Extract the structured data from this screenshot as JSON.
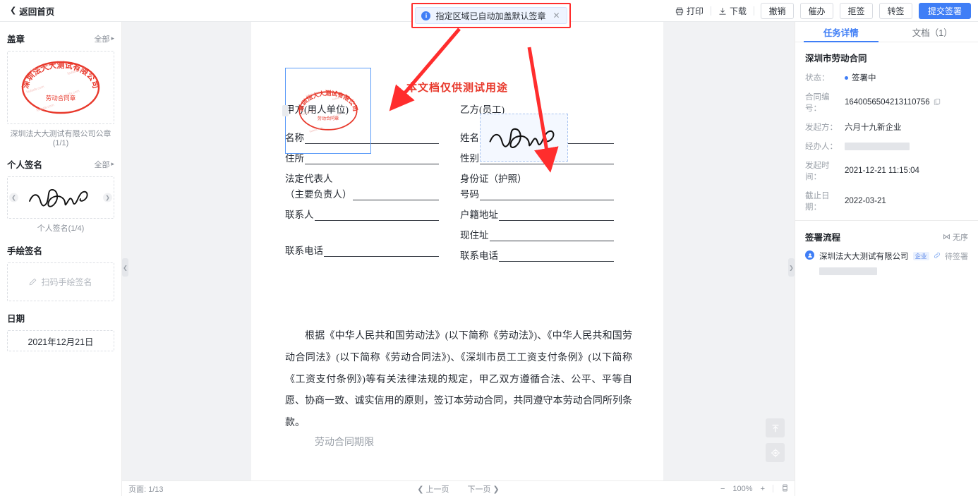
{
  "topbar": {
    "back_label": "返回首页",
    "actions_text": [
      {
        "id": "print",
        "label": "打印",
        "icon": "printer-icon"
      },
      {
        "id": "download",
        "label": "下载",
        "icon": "download-icon"
      }
    ],
    "actions_buttons": [
      {
        "id": "revoke",
        "label": "撤销"
      },
      {
        "id": "urge",
        "label": "催办"
      },
      {
        "id": "reject",
        "label": "拒签"
      },
      {
        "id": "transfer",
        "label": "转签"
      }
    ],
    "primary_button": "提交签署"
  },
  "notice": {
    "text": "指定区域已自动加盖默认签章",
    "info_glyph": "i",
    "close_glyph": "✕"
  },
  "sidebar": {
    "sections": [
      {
        "title": "盖章",
        "all_label": "全部",
        "caption": "深圳法大大测试有限公司公章(1/1)"
      },
      {
        "title": "个人签名",
        "all_label": "全部",
        "caption": "个人签名(1/4)"
      },
      {
        "title": "手绘签名",
        "placeholder": "扫码手绘签名"
      },
      {
        "title": "日期",
        "value": "2021年12月21日"
      }
    ]
  },
  "document": {
    "watermark_top": "本文档仅供测试用途",
    "watermark_mid": "本文档仅供测试用途",
    "party_a_label": "甲方(用人单位)",
    "party_b_label": "乙方(员工)",
    "party_a_fields": [
      "名称",
      "住所",
      "法定代表人",
      "（主要负责人）",
      "联系人",
      "联系电话"
    ],
    "party_b_fields": [
      "姓名",
      "性别",
      "身份证（护照）",
      "号码",
      "户籍地址",
      "现住址",
      "联系电话"
    ],
    "paragraph": "根据《中华人民共和国劳动法》(以下简称《劳动法》)、《中华人民共和国劳动合同法》(以下简称《劳动合同法》)、《深圳市员工工资支付条例》(以下简称《工资支付条例》)等有关法律法规的规定，甲乙双方遵循合法、公平、平等自愿、协商一致、诚实信用的原则，签订本劳动合同，共同遵守本劳动合同所列条款。",
    "paragraph_tail": "劳动合同期限",
    "seal_text_outer": "深圳法大大测试有限公司",
    "seal_text_inner": "劳动合同章"
  },
  "bottombar": {
    "page_label": "页面: 1/13",
    "prev_label": "上一页",
    "next_label": "下一页",
    "zoom_out": "−",
    "zoom_level": "100%",
    "zoom_in": "+"
  },
  "rightpanel": {
    "tabs": [
      {
        "id": "task-detail",
        "label": "任务详情",
        "active": true
      },
      {
        "id": "documents",
        "label": "文档（1）",
        "active": false
      }
    ],
    "doc_title": "深圳市劳动合同",
    "details": [
      {
        "key": "状态：",
        "value": "签署中",
        "type": "status"
      },
      {
        "key": "合同编号：",
        "value": "1640056504213110756",
        "type": "copyable"
      },
      {
        "key": "发起方：",
        "value": "六月十九新企业",
        "type": "text"
      },
      {
        "key": "经办人：",
        "value": "",
        "type": "redacted",
        "redact_width": 92
      },
      {
        "key": "发起时间：",
        "value": "2021-12-21 11:15:04",
        "type": "text"
      },
      {
        "key": "截止日期：",
        "value": "2022-03-21",
        "type": "text"
      }
    ],
    "flow": {
      "title": "签署流程",
      "order_label": "无序",
      "entries": [
        {
          "name": "深圳法大大测试有限公司",
          "tag": "企业",
          "status": "待签署",
          "redact_width": 82
        }
      ]
    }
  },
  "colors": {
    "accent": "#3f7ef6",
    "annotation_red": "#ff2d2d",
    "seal_red": "#e8392c",
    "muted": "#8a9099"
  }
}
